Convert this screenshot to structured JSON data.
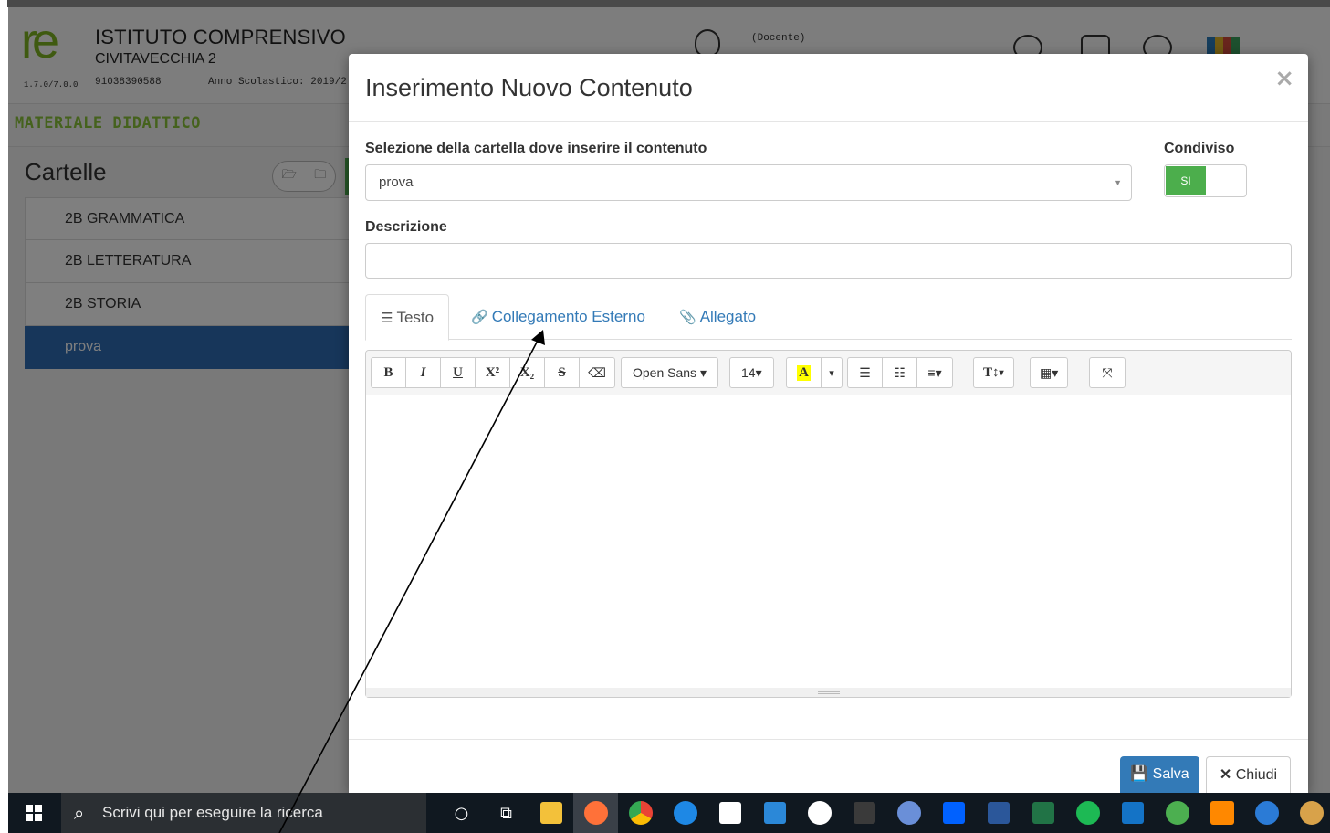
{
  "app": {
    "logo_text": "re",
    "version": "1.7.0/7.0.0",
    "school_name": "ISTITUTO COMPRENSIVO",
    "school_city": "CIVITAVECCHIA 2",
    "school_code": "91038390588",
    "school_year": "Anno Scolastico: 2019/2",
    "user_role": "(Docente)",
    "section_title": "MATERIALE DIDATTICO",
    "folders_title": "Cartelle",
    "folders": [
      {
        "label": "2B GRAMMATICA",
        "active": false
      },
      {
        "label": "2B LETTERATURA",
        "active": false
      },
      {
        "label": "2B STORIA",
        "active": false
      },
      {
        "label": "prova",
        "active": true
      }
    ]
  },
  "modal": {
    "title": "Inserimento Nuovo Contenuto",
    "close_glyph": "×",
    "folder_label": "Selezione della cartella dove inserire il contenuto",
    "folder_value": "prova",
    "shared_label": "Condiviso",
    "shared_value": "SI",
    "description_label": "Descrizione",
    "description_value": "",
    "tabs": [
      {
        "label": "Testo",
        "icon": "align-left-icon",
        "active": true
      },
      {
        "label": "Collegamento Esterno",
        "icon": "link-icon",
        "active": false
      },
      {
        "label": "Allegato",
        "icon": "paperclip-icon",
        "active": false
      }
    ],
    "toolbar": {
      "bold": "B",
      "italic": "I",
      "underline": "U",
      "superscript": "X²",
      "subscript": "X₂",
      "strikethrough": "S",
      "eraser": "⌫",
      "font_family": "Open Sans",
      "font_size": "14",
      "color": "A",
      "unordered_list": "☰",
      "ordered_list": "☷",
      "align": "≡",
      "line_height": "T↕",
      "table": "▦",
      "fullscreen": "⤧"
    },
    "save_label": "Salva",
    "close_label": "Chiudi"
  },
  "taskbar": {
    "search_placeholder": "Scrivi qui per eseguire la ricerca",
    "apps": [
      {
        "name": "cortana-icon",
        "color": "#ffffff"
      },
      {
        "name": "task-view-icon",
        "color": "#ffffff"
      },
      {
        "name": "file-explorer-icon",
        "color": "#f3c13a"
      },
      {
        "name": "firefox-icon",
        "color": "#ff7139"
      },
      {
        "name": "chrome-icon",
        "color": "#34a853"
      },
      {
        "name": "edge-icon",
        "color": "#1e88e5"
      },
      {
        "name": "store-icon",
        "color": "#ffffff"
      },
      {
        "name": "mail-icon",
        "color": "#2b88d8"
      },
      {
        "name": "paint-icon",
        "color": "#ffffff"
      },
      {
        "name": "dots-icon",
        "color": "#3a3a3a"
      },
      {
        "name": "qbittorrent-icon",
        "color": "#6a8fd8"
      },
      {
        "name": "dropbox-icon",
        "color": "#0061ff"
      },
      {
        "name": "word-icon",
        "color": "#2b579a"
      },
      {
        "name": "excel-icon",
        "color": "#217346"
      },
      {
        "name": "spotify-icon",
        "color": "#1db954"
      },
      {
        "name": "photoshop-icon",
        "color": "#1473c6"
      },
      {
        "name": "compass-icon",
        "color": "#4caf50"
      },
      {
        "name": "vlc-icon",
        "color": "#ff8800"
      },
      {
        "name": "thunderbird-icon",
        "color": "#2b7bd6"
      },
      {
        "name": "pizza-icon",
        "color": "#d8a24a"
      }
    ]
  }
}
